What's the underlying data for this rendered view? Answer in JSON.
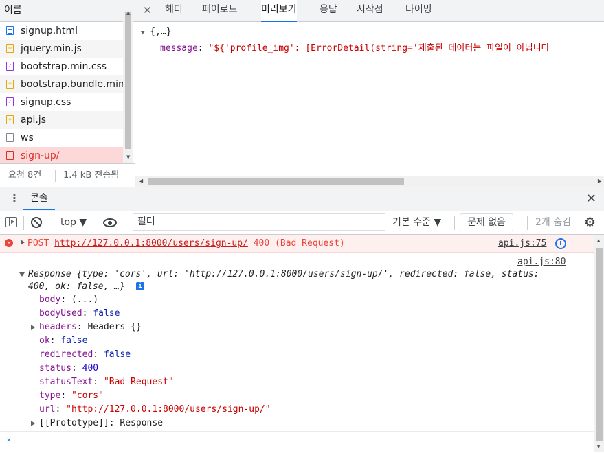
{
  "network": {
    "name_header": "이름",
    "files": [
      {
        "name": "signup.html",
        "type": "doc"
      },
      {
        "name": "jquery.min.js",
        "type": "js"
      },
      {
        "name": "bootstrap.min.css",
        "type": "css"
      },
      {
        "name": "bootstrap.bundle.min.js",
        "type": "js"
      },
      {
        "name": "signup.css",
        "type": "css"
      },
      {
        "name": "api.js",
        "type": "js"
      },
      {
        "name": "ws",
        "type": "plain"
      },
      {
        "name": "sign-up/",
        "type": "error",
        "selected": true
      }
    ],
    "status": {
      "requests": "요청 8건",
      "transferred": "1.4 kB 전송됨"
    }
  },
  "detail_tabs": [
    "헤더",
    "페이로드",
    "미리보기",
    "응답",
    "시작점",
    "타이밍"
  ],
  "active_tab": "미리보기",
  "preview": {
    "root": "{,…}",
    "message_key": "message",
    "message_value": "\"${'profile_img': [ErrorDetail(string='제출된 데이터는 파일이 아닙니다"
  },
  "drawer": {
    "tab": "콘솔"
  },
  "toolbar": {
    "context": "top ▼",
    "filter_placeholder": "필터",
    "levels": "기본 수준 ▼",
    "issues": "문제 없음",
    "hidden": "2개 숨김"
  },
  "console": {
    "error": {
      "method": "POST",
      "url": "http://127.0.0.1:8000/users/sign-up/",
      "status": "400 (Bad Request)",
      "source": "api.js:75"
    },
    "log": {
      "source": "api.js:80",
      "line1_prefix": "Response {",
      "line1_rest": "type: 'cors', url: 'http://127.0.0.1:8000/users/sign-up/', redirected: false, status:",
      "line2": "400, ok: false, …}",
      "info_badge": "i",
      "props": [
        {
          "key": "body",
          "value": "(...)",
          "kind": "plain",
          "expandable": false
        },
        {
          "key": "bodyUsed",
          "value": "false",
          "kind": "kw",
          "expandable": false
        },
        {
          "key": "headers",
          "value": "Headers {}",
          "kind": "plain",
          "expandable": true
        },
        {
          "key": "ok",
          "value": "false",
          "kind": "kw",
          "expandable": false
        },
        {
          "key": "redirected",
          "value": "false",
          "kind": "kw",
          "expandable": false
        },
        {
          "key": "status",
          "value": "400",
          "kind": "num",
          "expandable": false
        },
        {
          "key": "statusText",
          "value": "\"Bad Request\"",
          "kind": "str",
          "expandable": false
        },
        {
          "key": "type",
          "value": "\"cors\"",
          "kind": "str",
          "expandable": false
        },
        {
          "key": "url",
          "value": "\"http://127.0.0.1:8000/users/sign-up/\"",
          "kind": "str",
          "expandable": false
        },
        {
          "key": "[[Prototype]]",
          "value": "Response",
          "kind": "plain",
          "expandable": true
        }
      ]
    },
    "prompt": "›"
  }
}
